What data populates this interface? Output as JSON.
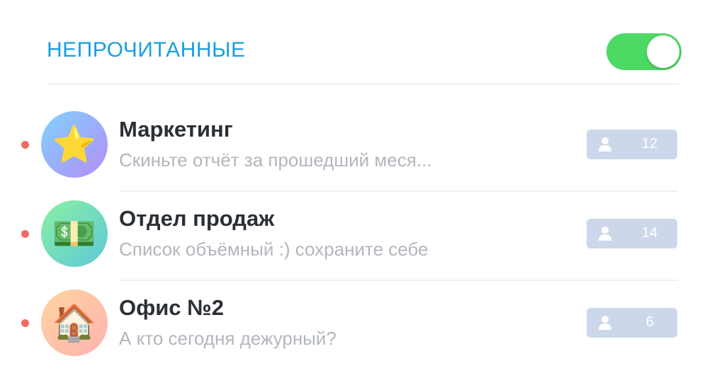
{
  "header": {
    "title": "НЕПРОЧИТАННЫЕ",
    "toggle_on": true,
    "toggle_color": "#4cd964"
  },
  "chats": [
    {
      "title": "Маркетинг",
      "preview": "Скиньте отчёт за прошедший меся...",
      "avatar_icon": "star-icon",
      "avatar_glyph": "⭐",
      "members": "12",
      "unread": true
    },
    {
      "title": "Отдел продаж",
      "preview": "Список объёмный :) сохраните себе",
      "avatar_icon": "money-icon",
      "avatar_glyph": "💵",
      "members": "14",
      "unread": true
    },
    {
      "title": "Офис №2",
      "preview": "А кто сегодня дежурный?",
      "avatar_icon": "house-icon",
      "avatar_glyph": "🏠",
      "members": "6",
      "unread": true
    }
  ],
  "colors": {
    "accent": "#1a9fe0",
    "unread_dot": "#f06a64",
    "badge": "#cdd7ea"
  }
}
